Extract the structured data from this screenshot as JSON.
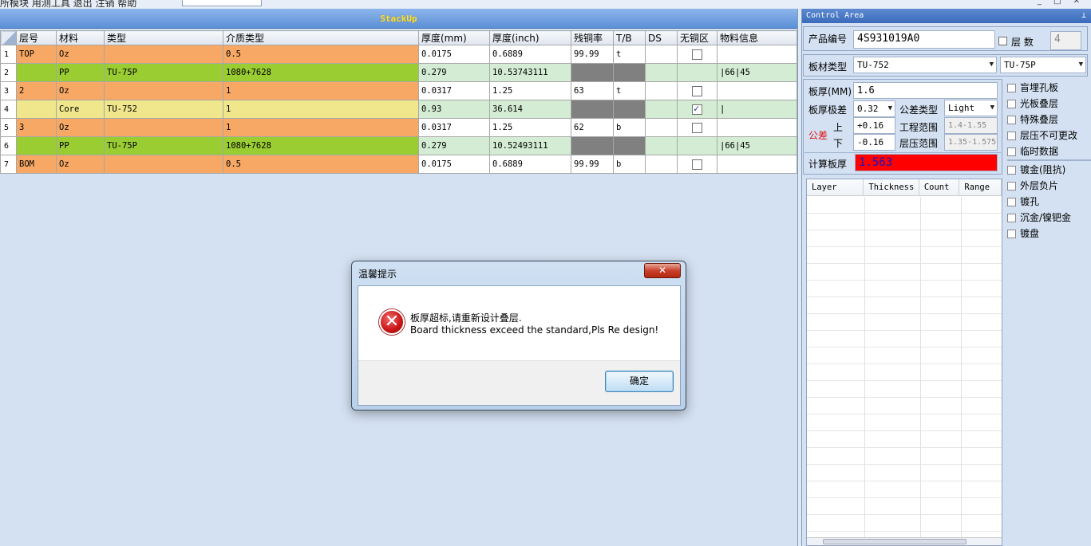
{
  "menubar": {
    "text": "所模块   用测工具   退出   注销   帮助"
  },
  "stackup": {
    "title": "StackUp",
    "columns": [
      "层号",
      "材料",
      "类型",
      "介质类型",
      "厚度(mm)",
      "厚度(inch)",
      "残铜率",
      "T/B",
      "DS",
      "无铜区",
      "物料信息"
    ],
    "rows": [
      {
        "num": "1",
        "layer": "TOP",
        "material": "Oz",
        "type": "",
        "dielectric": "0.5",
        "thk_mm": "0.0175",
        "thk_inch": "0.6889",
        "residual": "99.99",
        "tb": "t",
        "ds": "",
        "nocu": false,
        "info": "",
        "style": "orange"
      },
      {
        "num": "2",
        "layer": "",
        "material": "PP",
        "type": "TU-75P",
        "dielectric": "1080+7628",
        "thk_mm": "0.279",
        "thk_inch": "10.53743111",
        "residual": "",
        "tb": "",
        "ds": "",
        "nocu": null,
        "info": "|66|45",
        "style": "green"
      },
      {
        "num": "3",
        "layer": "2",
        "material": "Oz",
        "type": "",
        "dielectric": "1",
        "thk_mm": "0.0317",
        "thk_inch": "1.25",
        "residual": "63",
        "tb": "t",
        "ds": "",
        "nocu": false,
        "info": "",
        "style": "orange"
      },
      {
        "num": "4",
        "layer": "",
        "material": "Core",
        "type": "TU-752",
        "dielectric": "1",
        "thk_mm": "0.93",
        "thk_inch": "36.614",
        "residual": "",
        "tb": "",
        "ds": "",
        "nocu": true,
        "info": "|",
        "style": "yellow"
      },
      {
        "num": "5",
        "layer": "3",
        "material": "Oz",
        "type": "",
        "dielectric": "1",
        "thk_mm": "0.0317",
        "thk_inch": "1.25",
        "residual": "62",
        "tb": "b",
        "ds": "",
        "nocu": false,
        "info": "",
        "style": "orange"
      },
      {
        "num": "6",
        "layer": "",
        "material": "PP",
        "type": "TU-75P",
        "dielectric": "1080+7628",
        "thk_mm": "0.279",
        "thk_inch": "10.52493111",
        "residual": "",
        "tb": "",
        "ds": "",
        "nocu": null,
        "info": "|66|45",
        "style": "green"
      },
      {
        "num": "7",
        "layer": "BOM",
        "material": "Oz",
        "type": "",
        "dielectric": "0.5",
        "thk_mm": "0.0175",
        "thk_inch": "0.6889",
        "residual": "99.99",
        "tb": "b",
        "ds": "",
        "nocu": false,
        "info": "",
        "style": "orange"
      }
    ]
  },
  "control": {
    "title": "Control Area",
    "pin_icon": "pin-icon",
    "product_label": "产品编号",
    "product_value": "4S931019A0",
    "layer_label": "层  数",
    "layer_value": "4",
    "material_label": "板材类型",
    "material_value": "TU-752",
    "pp_value": "TU-75P",
    "thickness_label": "板厚(MM)",
    "thickness_value": "1.6",
    "tol_range_label": "板厚极差",
    "tol_range_value": "0.32",
    "tol_type_label": "公差类型",
    "tol_type_value": "Light",
    "tol_label": "公差",
    "upper_label": "上",
    "lower_label": "下",
    "upper_value": "+0.16",
    "lower_value": "-0.16",
    "eng_range_label": "工程范围",
    "eng_range_value": "1.4-1.55",
    "press_range_label": "层压范围",
    "press_range_value": "1.35-1.575",
    "calc_label": "计算板厚",
    "calc_value": "1.563",
    "count_columns": [
      "Layer",
      "Thickness",
      "Count",
      "Range"
    ]
  },
  "side_options": {
    "group1": [
      "盲埋孔板",
      "光板叠层",
      "特殊叠层",
      "层压不可更改",
      "临时数据"
    ],
    "group2": [
      "镀金(阻抗)",
      "外层负片",
      "镀孔",
      "沉金/镍钯金",
      "镀盘"
    ]
  },
  "dialog": {
    "title": "温馨提示",
    "line1": "板厚超标,请重新设计叠层.",
    "line2": "Board thickness exceed the standard,Pls Re design!",
    "ok_label": "确定",
    "close_label": "✕",
    "icon": "error-icon"
  },
  "colors": {
    "copper": "#f6a864",
    "prepreg": "#9acd32",
    "core": "#f0e68c",
    "result_bg": "#ff0000",
    "result_text": "#1414c8"
  }
}
